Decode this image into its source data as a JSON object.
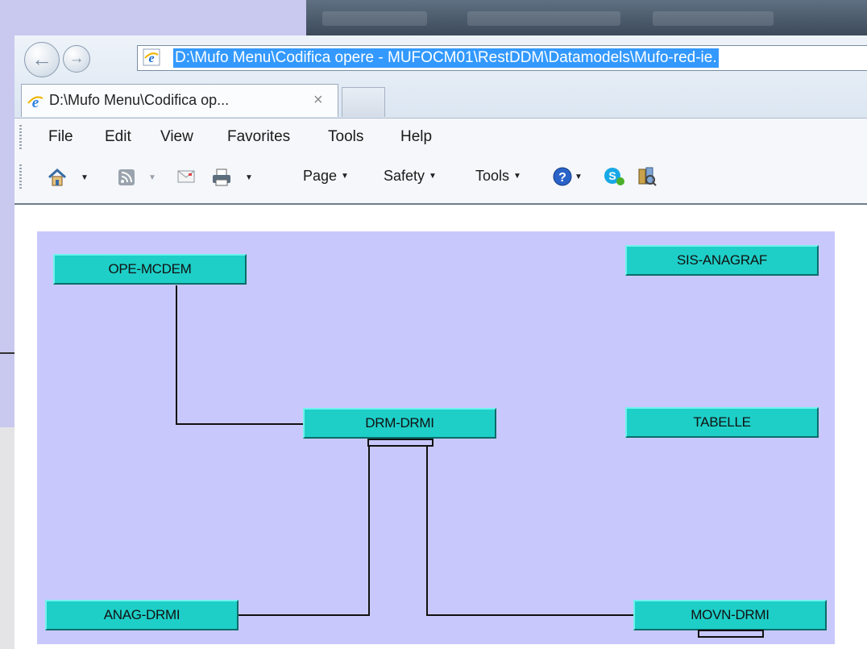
{
  "browser": {
    "address_url": "D:\\Mufo Menu\\Codifica opere - MUFOCM01\\RestDDM\\Datamodels\\Mufo-red-ie.",
    "tab_title": "D:\\Mufo Menu\\Codifica op...",
    "tab_close": "×",
    "back_icon": "back-arrow-icon",
    "forward_icon": "forward-arrow-icon"
  },
  "menu": {
    "items": [
      "File",
      "Edit",
      "View",
      "Favorites",
      "Tools",
      "Help"
    ]
  },
  "command_bar": {
    "page": "Page",
    "safety": "Safety",
    "tools": "Tools",
    "icons": [
      "home-icon",
      "rss-feed-icon",
      "read-mail-icon",
      "print-icon",
      "help-icon",
      "skype-icon",
      "research-icon"
    ]
  },
  "diagram": {
    "entities": {
      "ope_mcdem": "OPE-MCDEM",
      "sis_anagraf": "SIS-ANAGRAF",
      "drm_drmi": "DRM-DRMI",
      "tabelle": "TABELLE",
      "anag_drmi": "ANAG-DRMI",
      "movn_drmi": "MOVN-DRMI"
    },
    "colors": {
      "canvas": "#c9c8fc",
      "entity_fill": "#1ecfc8",
      "line": "#111111"
    }
  }
}
